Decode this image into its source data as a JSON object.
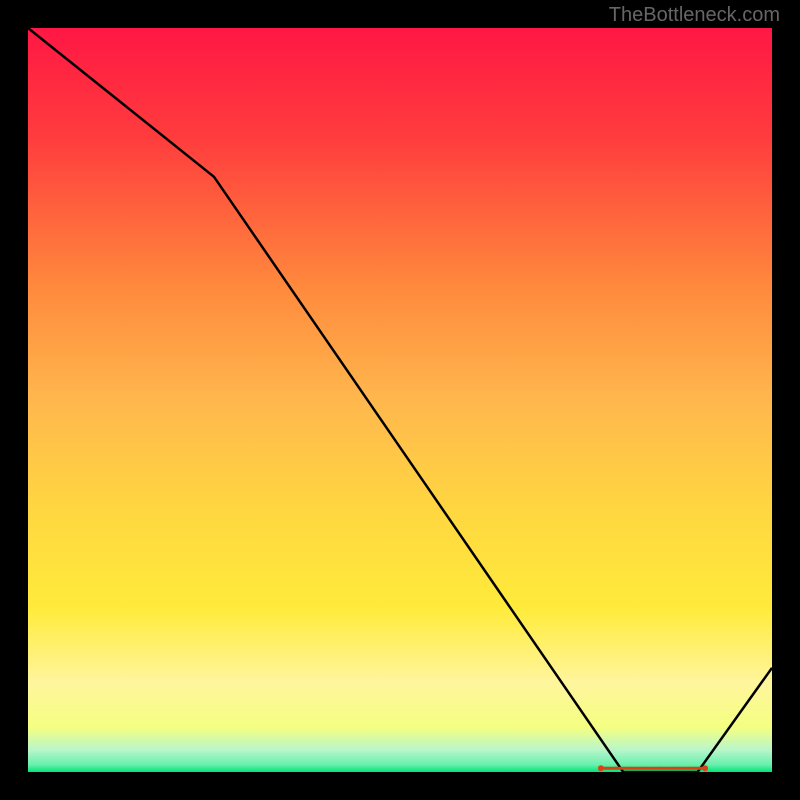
{
  "watermark": "TheBottleneck.com",
  "chart_data": {
    "type": "line",
    "title": "",
    "xlabel": "",
    "ylabel": "",
    "xlim": [
      0,
      100
    ],
    "ylim": [
      0,
      100
    ],
    "x": [
      0,
      25,
      80,
      90,
      100
    ],
    "y": [
      100,
      80,
      0,
      0,
      14
    ],
    "gradient_stops": [
      {
        "offset": 0,
        "color": "#FF1744"
      },
      {
        "offset": 0.15,
        "color": "#FF3D3D"
      },
      {
        "offset": 0.35,
        "color": "#FF8A3D"
      },
      {
        "offset": 0.5,
        "color": "#FFB74D"
      },
      {
        "offset": 0.65,
        "color": "#FFD740"
      },
      {
        "offset": 0.78,
        "color": "#FFEB3B"
      },
      {
        "offset": 0.88,
        "color": "#FFF59D"
      },
      {
        "offset": 0.94,
        "color": "#F4FF81"
      },
      {
        "offset": 0.97,
        "color": "#B9F6CA"
      },
      {
        "offset": 0.99,
        "color": "#69F0AE"
      },
      {
        "offset": 1,
        "color": "#00E676"
      }
    ],
    "marker_region": {
      "x_start": 77,
      "x_end": 91,
      "y": 0.5,
      "color": "#D84315"
    }
  }
}
